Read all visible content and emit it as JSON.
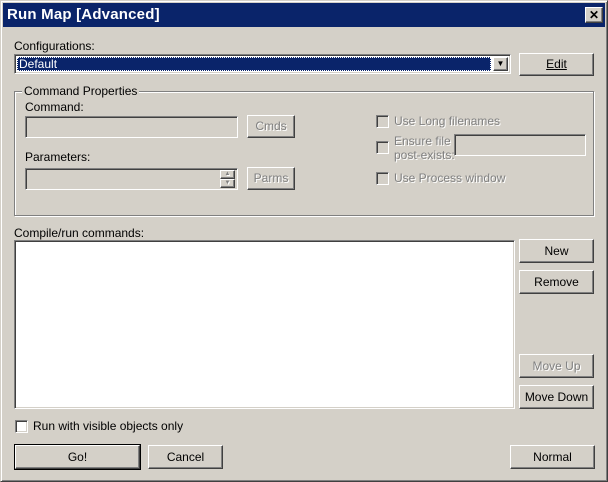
{
  "window": {
    "title": "Run Map [Advanced]"
  },
  "configurations": {
    "label": "Configurations:",
    "selected": "Default",
    "edit_button": "Edit"
  },
  "command_properties": {
    "group_title": "Command Properties",
    "command_label": "Command:",
    "command_value": "",
    "cmds_button": "Cmds",
    "parameters_label": "Parameters:",
    "parameters_value": "",
    "parms_button": "Parms",
    "use_long_filenames": {
      "label": "Use Long filenames",
      "checked": false
    },
    "ensure_file_line1": "Ensure file",
    "ensure_file_line2": "post-exists:",
    "ensure_file_value": "",
    "use_process_window": {
      "label": "Use Process window",
      "checked": false
    }
  },
  "compile_run": {
    "label": "Compile/run commands:",
    "items": [],
    "new_button": "New",
    "remove_button": "Remove",
    "move_up_button": "Move Up",
    "move_down_button": "Move Down"
  },
  "run_visible_only": {
    "label": "Run with visible objects only",
    "checked": false
  },
  "footer": {
    "go_button": "Go!",
    "cancel_button": "Cancel",
    "normal_button": "Normal"
  },
  "colors": {
    "titlebar": "#0a246a",
    "face": "#d4d0c8",
    "selection": "#0a246a"
  },
  "icons": {
    "close": "close-icon",
    "dropdown": "chevron-down-icon",
    "spin_up": "spin-up-icon",
    "spin_down": "spin-down-icon"
  }
}
